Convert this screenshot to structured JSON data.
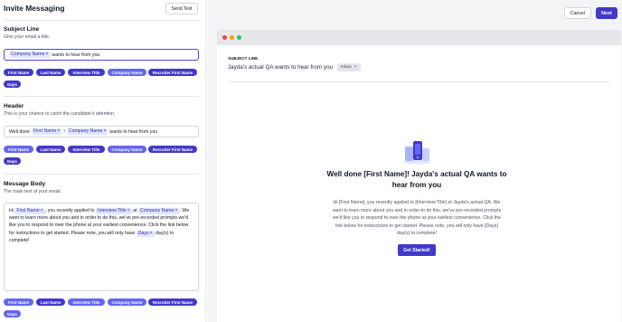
{
  "header": {
    "title": "Invite Messaging",
    "send_test": "Send Test",
    "cancel": "Cancel",
    "next": "Next"
  },
  "subject": {
    "title": "Subject Line",
    "subtitle": "Give your email a title.",
    "token1": "Company Name",
    "text1": "wants to hear from you"
  },
  "header_section": {
    "title": "Header",
    "subtitle": "This is your chance to catch the candidate's attention.",
    "text1": "Well done",
    "token1": "First Name",
    "text2": "!",
    "token2": "Company Name",
    "text3": "wants to hear from you"
  },
  "message": {
    "title": "Message Body",
    "subtitle": "The main text of your email.",
    "t1": "Hi",
    "tok1": "First Name",
    "t2": ", you recently applied to",
    "tok2": "Interview Title",
    "t3": "at",
    "tok3": "Company Name",
    "t4": ". We want to learn more about you and in order to do this, we've pre-recorded prompts we'd like you to respond to over the phone at your earliest convenience. Click the link below for instructions to get started. Please note, you will only have",
    "tok4": "Days",
    "t5": "day(s) to complete!"
  },
  "chips": [
    "First Name",
    "Last Name",
    "Interview Title",
    "Company Name",
    "Recruiter First Name",
    "Days"
  ],
  "preview": {
    "subject_label": "SUBJECT LINE",
    "subject_text": "Jayda's actual QA wants to hear from you",
    "inbox": "Inbox",
    "email_title": "Well done [First Name]! Jayda's actual QA wants to hear from you",
    "email_body": "Hi [First Name], you recently applied to [Interview Title] at Jayda's actual QA. We want to learn more about you and in order to do this, we've pre-recorded prompts we'd like you to respond to over the phone at your earliest convenience. Click the link below for instructions to get started. Please note, you will only have [Days] day(s) to complete!",
    "cta": "Get Started!"
  },
  "colors": {
    "primary": "#4338ca",
    "chip_light": "#6366f1",
    "token_bg": "#e0e7ff",
    "window_red": "#ef4444",
    "window_yellow": "#f59e0b",
    "window_green": "#22c55e"
  }
}
